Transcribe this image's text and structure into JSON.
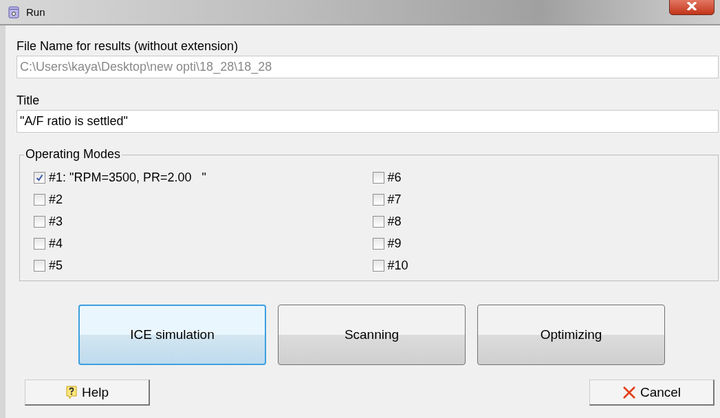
{
  "window": {
    "title": "Run"
  },
  "file_name": {
    "label": "File Name for results (without extension)",
    "value": "C:\\Users\\kaya\\Desktop\\new opti\\18_28\\18_28",
    "disabled": true
  },
  "title_field": {
    "label": "Title",
    "value": "\"A/F ratio is settled\""
  },
  "operating_modes": {
    "label": "Operating Modes",
    "modes": [
      {
        "label": "#1: \"RPM=3500, PR=2.00   \"",
        "checked": true
      },
      {
        "label": "#2",
        "checked": false
      },
      {
        "label": "#3",
        "checked": false
      },
      {
        "label": "#4",
        "checked": false
      },
      {
        "label": "#5",
        "checked": false
      },
      {
        "label": "#6",
        "checked": false
      },
      {
        "label": "#7",
        "checked": false
      },
      {
        "label": "#8",
        "checked": false
      },
      {
        "label": "#9",
        "checked": false
      },
      {
        "label": "#10",
        "checked": false
      }
    ]
  },
  "actions": [
    {
      "label": "ICE simulation",
      "focused": true
    },
    {
      "label": "Scanning",
      "focused": false
    },
    {
      "label": "Optimizing",
      "focused": false
    }
  ],
  "help_button": {
    "label": "Help"
  },
  "cancel_button": {
    "label": "Cancel"
  }
}
